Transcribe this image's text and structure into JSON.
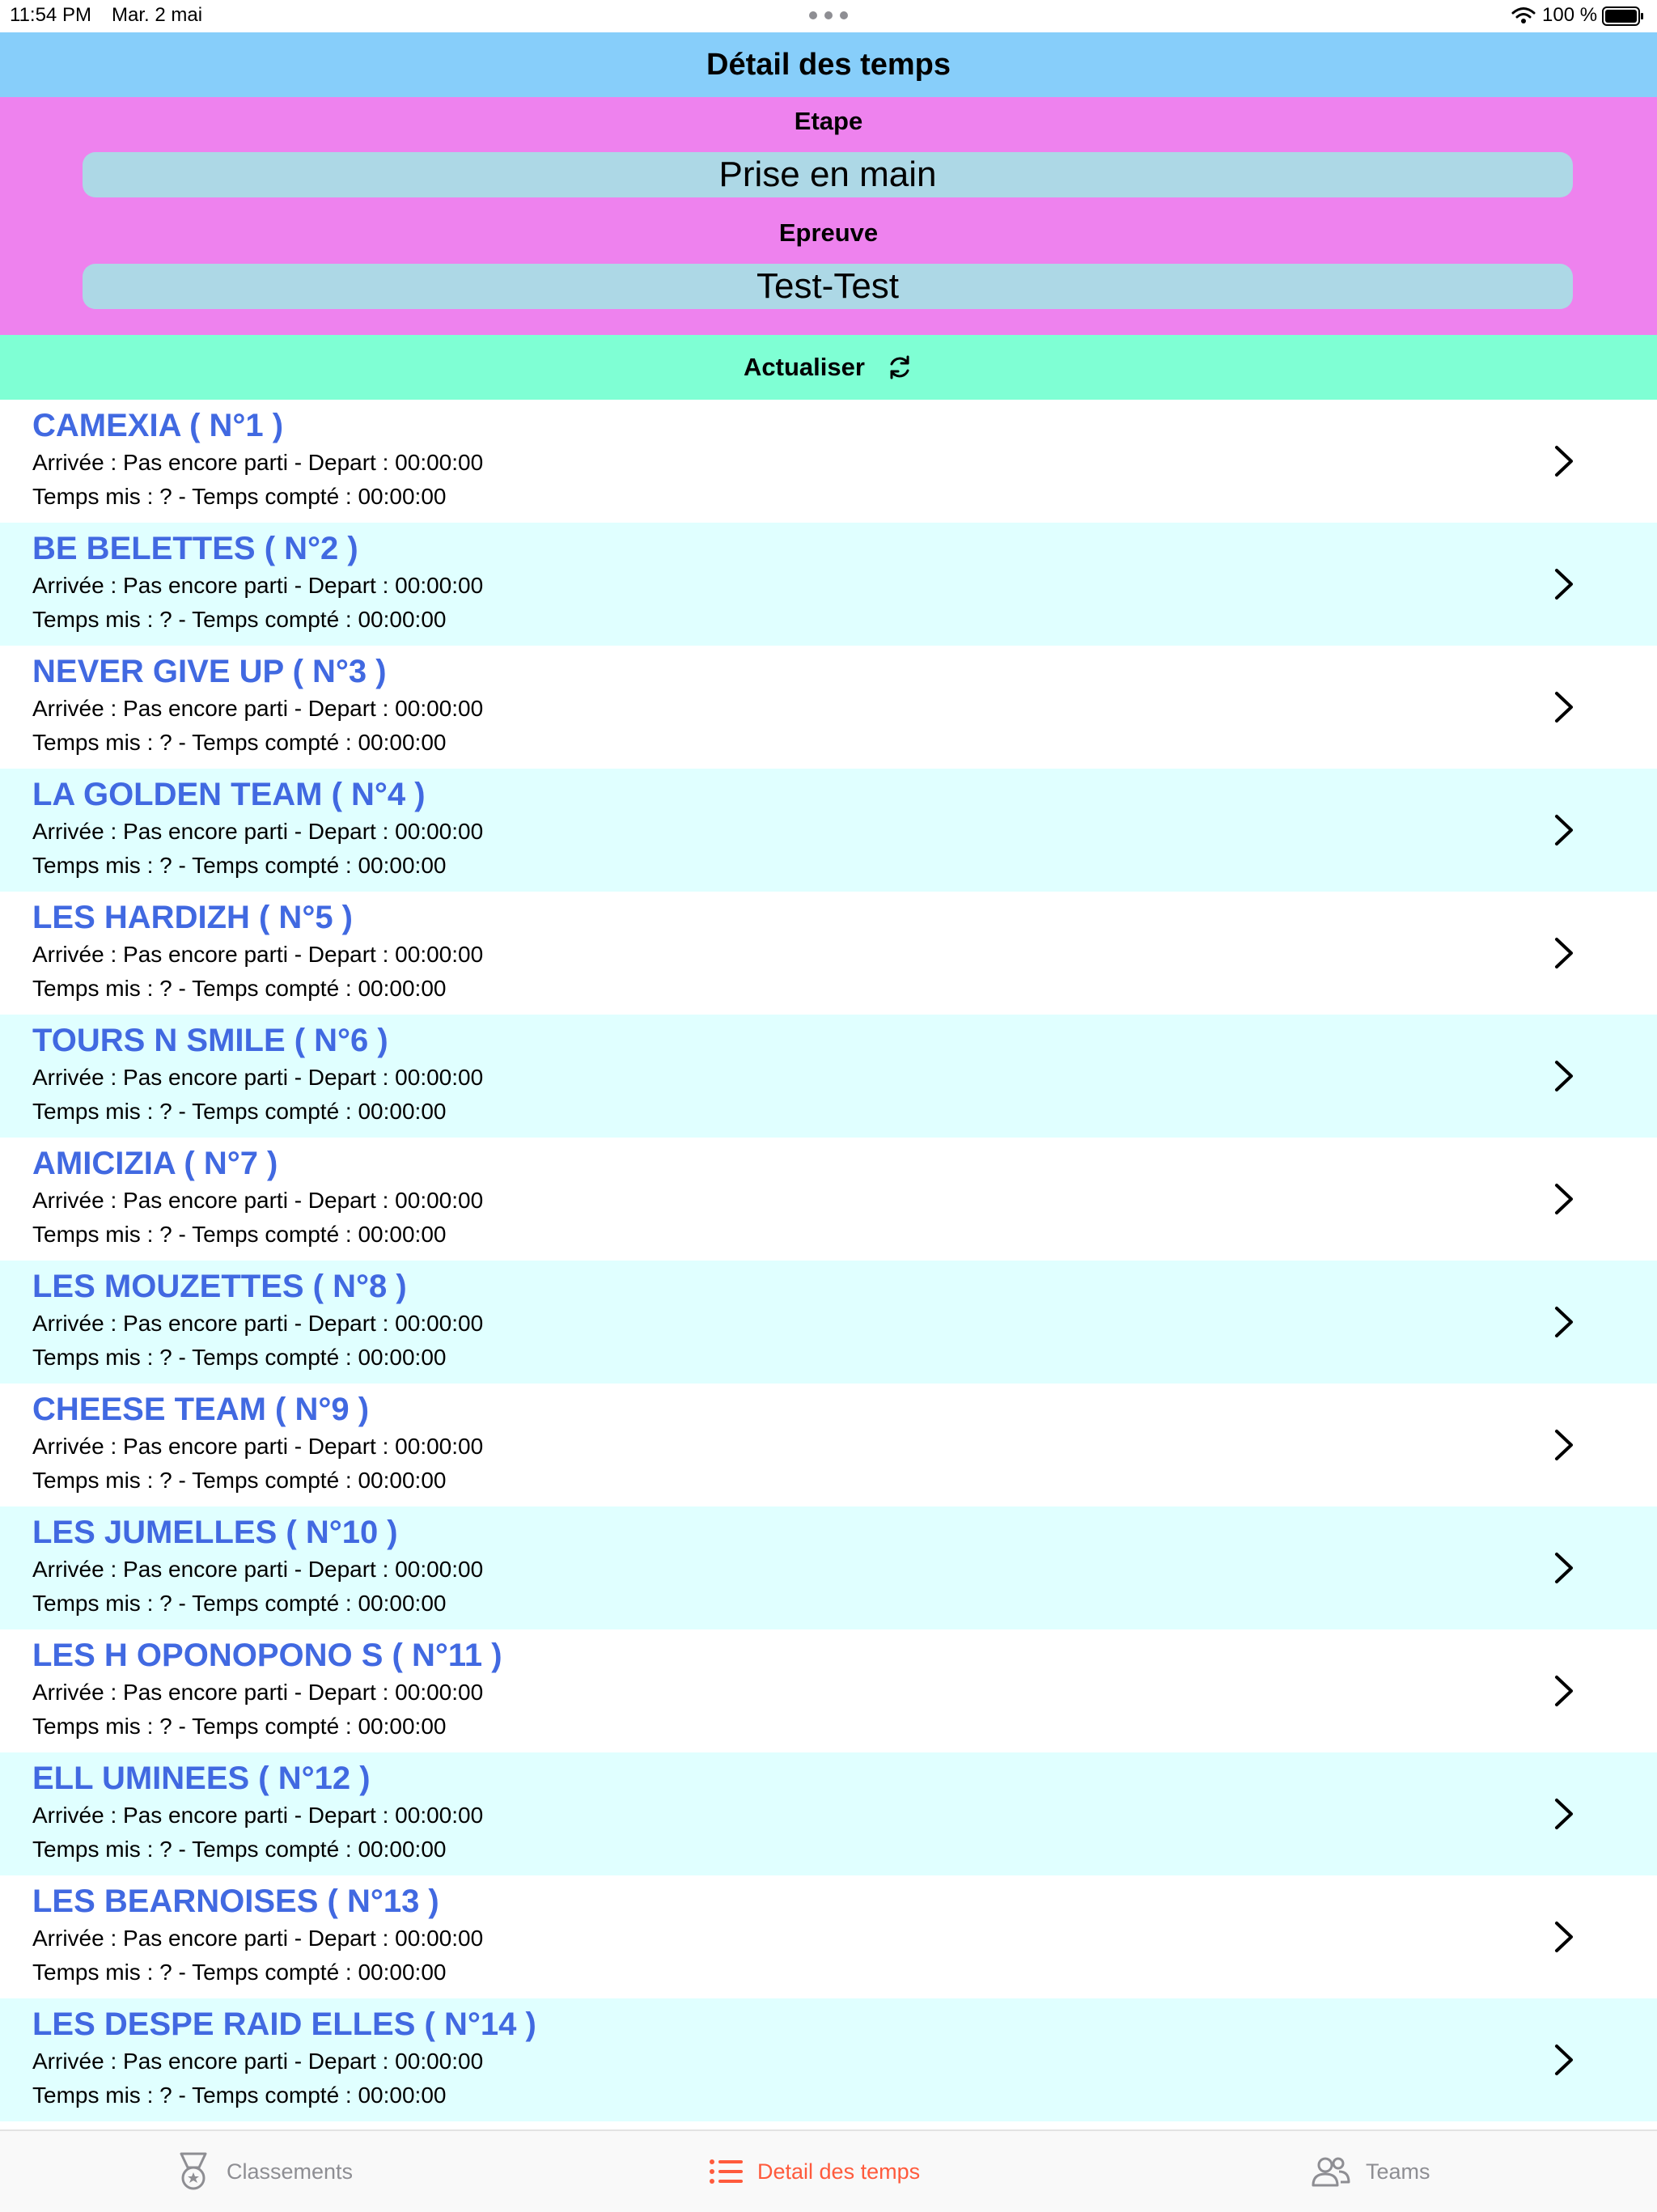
{
  "status_bar": {
    "time": "11:54 PM",
    "date": "Mar. 2 mai",
    "battery": "100 %"
  },
  "header": {
    "title": "Détail des temps"
  },
  "filters": {
    "etape_label": "Etape",
    "etape_value": "Prise en main",
    "epreuve_label": "Epreuve",
    "epreuve_value": "Test-Test"
  },
  "refresh": {
    "label": "Actualiser",
    "icon": "refresh-icon"
  },
  "teams": [
    {
      "name": "CAMEXIA ( N°1 )",
      "line1": "Arrivée : Pas encore parti - Depart : 00:00:00",
      "line2": "Temps mis : ? - Temps compté : 00:00:00"
    },
    {
      "name": "BE BELETTES ( N°2 )",
      "line1": "Arrivée : Pas encore parti - Depart : 00:00:00",
      "line2": "Temps mis : ? - Temps compté : 00:00:00"
    },
    {
      "name": "NEVER GIVE UP ( N°3 )",
      "line1": "Arrivée : Pas encore parti - Depart : 00:00:00",
      "line2": "Temps mis : ? - Temps compté : 00:00:00"
    },
    {
      "name": "LA GOLDEN TEAM ( N°4 )",
      "line1": "Arrivée : Pas encore parti - Depart : 00:00:00",
      "line2": "Temps mis : ? - Temps compté : 00:00:00"
    },
    {
      "name": "LES HARDIZH ( N°5 )",
      "line1": "Arrivée : Pas encore parti - Depart : 00:00:00",
      "line2": "Temps mis : ? - Temps compté : 00:00:00"
    },
    {
      "name": "TOURS N SMILE ( N°6 )",
      "line1": "Arrivée : Pas encore parti - Depart : 00:00:00",
      "line2": "Temps mis : ? - Temps compté : 00:00:00"
    },
    {
      "name": "AMICIZIA ( N°7 )",
      "line1": "Arrivée : Pas encore parti - Depart : 00:00:00",
      "line2": "Temps mis : ? - Temps compté : 00:00:00"
    },
    {
      "name": "LES MOUZETTES ( N°8 )",
      "line1": "Arrivée : Pas encore parti - Depart : 00:00:00",
      "line2": "Temps mis : ? - Temps compté : 00:00:00"
    },
    {
      "name": "CHEESE TEAM ( N°9 )",
      "line1": "Arrivée : Pas encore parti - Depart : 00:00:00",
      "line2": "Temps mis : ? - Temps compté : 00:00:00"
    },
    {
      "name": "LES JUMELLES ( N°10 )",
      "line1": "Arrivée : Pas encore parti - Depart : 00:00:00",
      "line2": "Temps mis : ? - Temps compté : 00:00:00"
    },
    {
      "name": "LES H OPONOPONO S ( N°11 )",
      "line1": "Arrivée : Pas encore parti - Depart : 00:00:00",
      "line2": "Temps mis : ? - Temps compté : 00:00:00"
    },
    {
      "name": "ELL UMINEES ( N°12 )",
      "line1": "Arrivée : Pas encore parti - Depart : 00:00:00",
      "line2": "Temps mis : ? - Temps compté : 00:00:00"
    },
    {
      "name": "LES BEARNOISES ( N°13 )",
      "line1": "Arrivée : Pas encore parti - Depart : 00:00:00",
      "line2": "Temps mis : ? - Temps compté : 00:00:00"
    },
    {
      "name": "LES DESPE RAID ELLES ( N°14 )",
      "line1": "Arrivée : Pas encore parti - Depart : 00:00:00",
      "line2": "Temps mis : ? - Temps compté : 00:00:00"
    }
  ],
  "tabs": [
    {
      "label": "Classements",
      "icon": "medal-icon",
      "active": false
    },
    {
      "label": "Detail des temps",
      "icon": "list-icon",
      "active": true
    },
    {
      "label": "Teams",
      "icon": "users-icon",
      "active": false
    }
  ],
  "colors": {
    "header": "#87cefa",
    "filters": "#ee82ee",
    "field": "#add8e6",
    "refresh": "#7fffd4",
    "row_alt": "#e0ffff",
    "team_name": "#4169e1",
    "tab_active": "#ff5a3c",
    "tab_inactive": "#8e8e93"
  }
}
